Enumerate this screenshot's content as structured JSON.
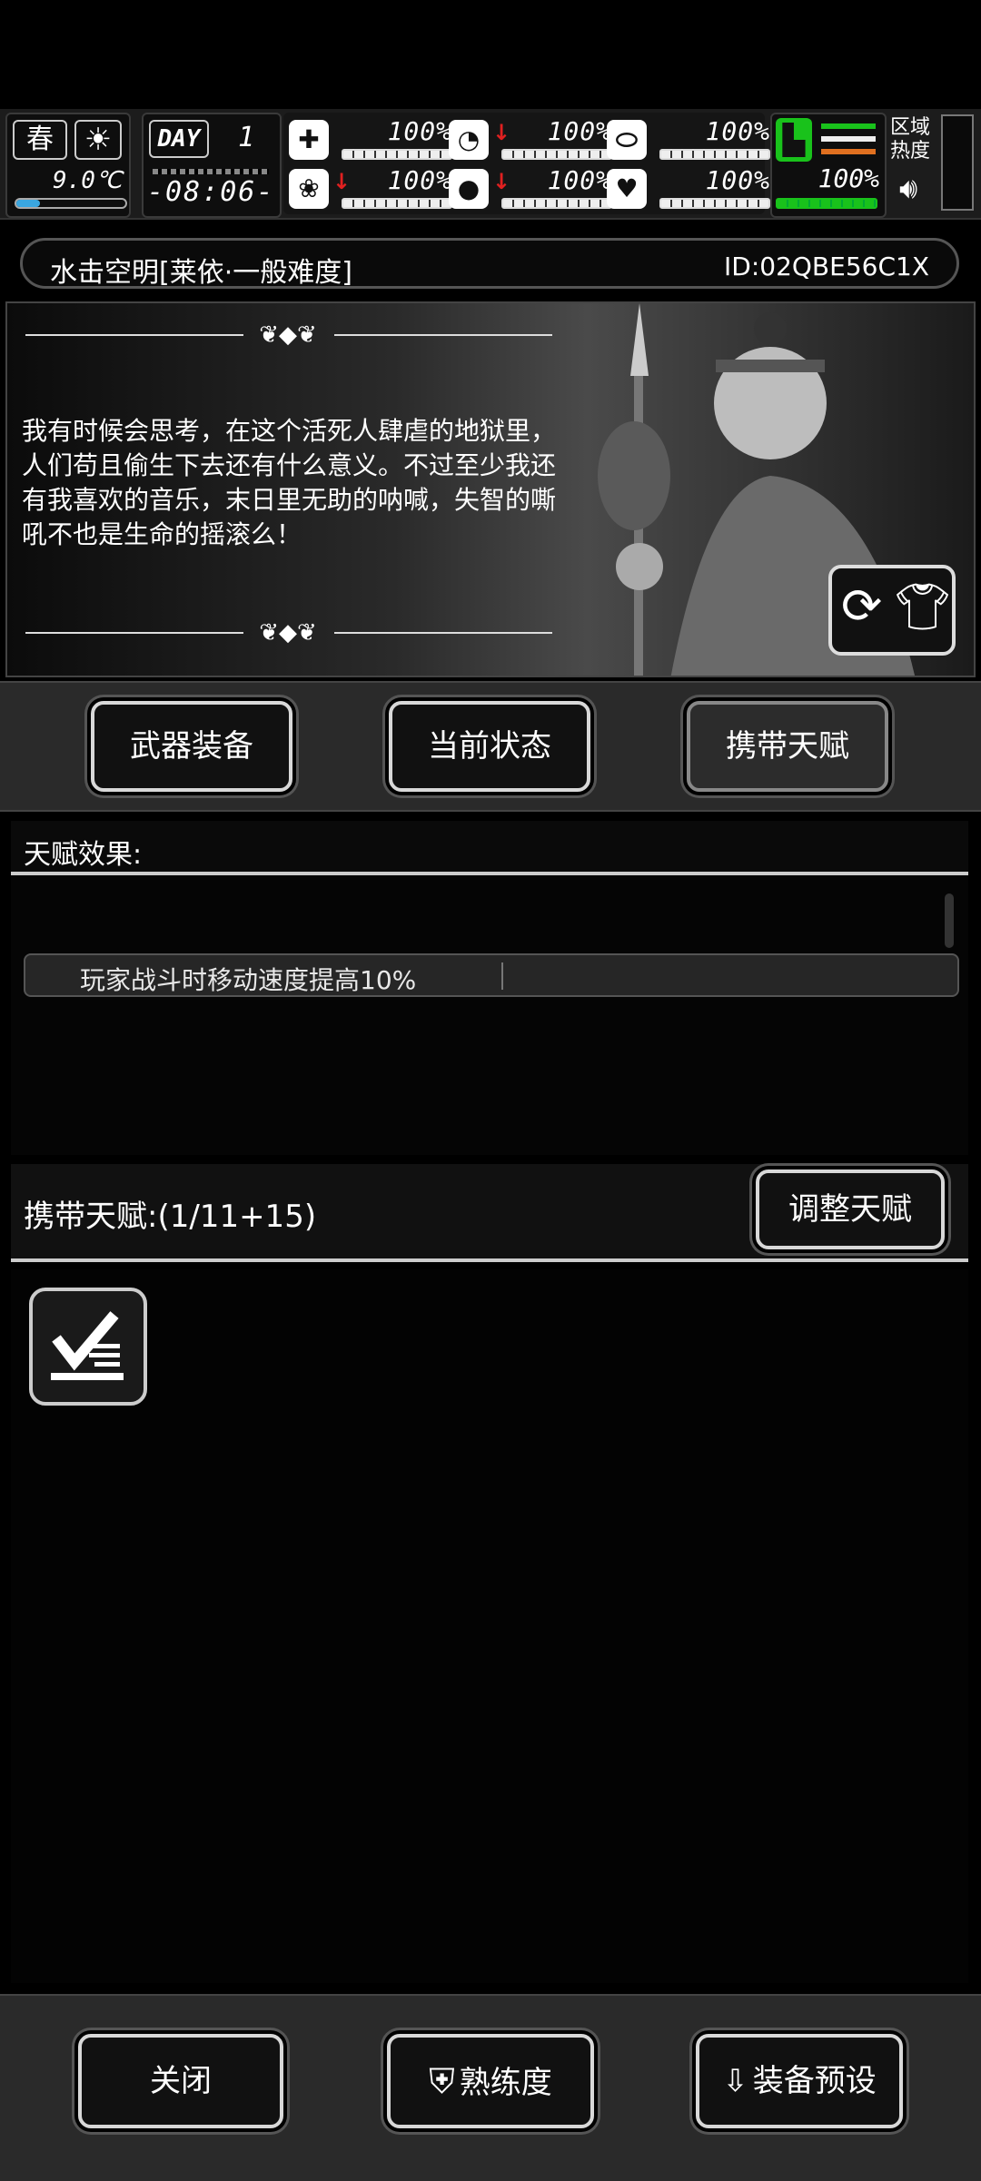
{
  "hud": {
    "season": "春",
    "temperature": "9.0℃",
    "day_label": "DAY",
    "day_number": "1",
    "clock": "-08:06-",
    "stats": [
      {
        "icon": "medkit-icon",
        "value": "100%",
        "down": false
      },
      {
        "icon": "stomach-icon",
        "value": "100%",
        "down": true
      },
      {
        "icon": "capsule-icon",
        "value": "100%",
        "down": false
      },
      {
        "icon": "brain-icon",
        "value": "100%",
        "down": true
      },
      {
        "icon": "water-drop-icon",
        "value": "100%",
        "down": true
      },
      {
        "icon": "heart-icon",
        "value": "100%",
        "down": false
      }
    ],
    "stamina_value": "100%",
    "zone_heat_label": "区域\n热度"
  },
  "title": {
    "name": "水击空明[莱依·一般难度]",
    "id": "ID:02QBE56C1X"
  },
  "banner": {
    "quote": "我有时候会思考，在这个活死人肆虐的地狱里，人们苟且偷生下去还有什么意义。不过至少我还有我喜欢的音乐，末日里无助的呐喊，失智的嘶吼不也是生命的摇滚么！"
  },
  "tabs": {
    "weapons": "武器装备",
    "status": "当前状态",
    "talents": "携带天赋"
  },
  "effects": {
    "heading": "天赋效果:",
    "items": [
      "玩家战斗时移动速度提高10%"
    ]
  },
  "carried": {
    "heading": "携带天赋:(1/11+15)",
    "adjust": "调整天赋"
  },
  "bottom": {
    "close": "关闭",
    "proficiency": "熟练度",
    "preset": "装备预设"
  },
  "colors": {
    "accent_green": "#19c21b",
    "down_red": "#e02020",
    "water_blue": "#3aa6e0"
  }
}
